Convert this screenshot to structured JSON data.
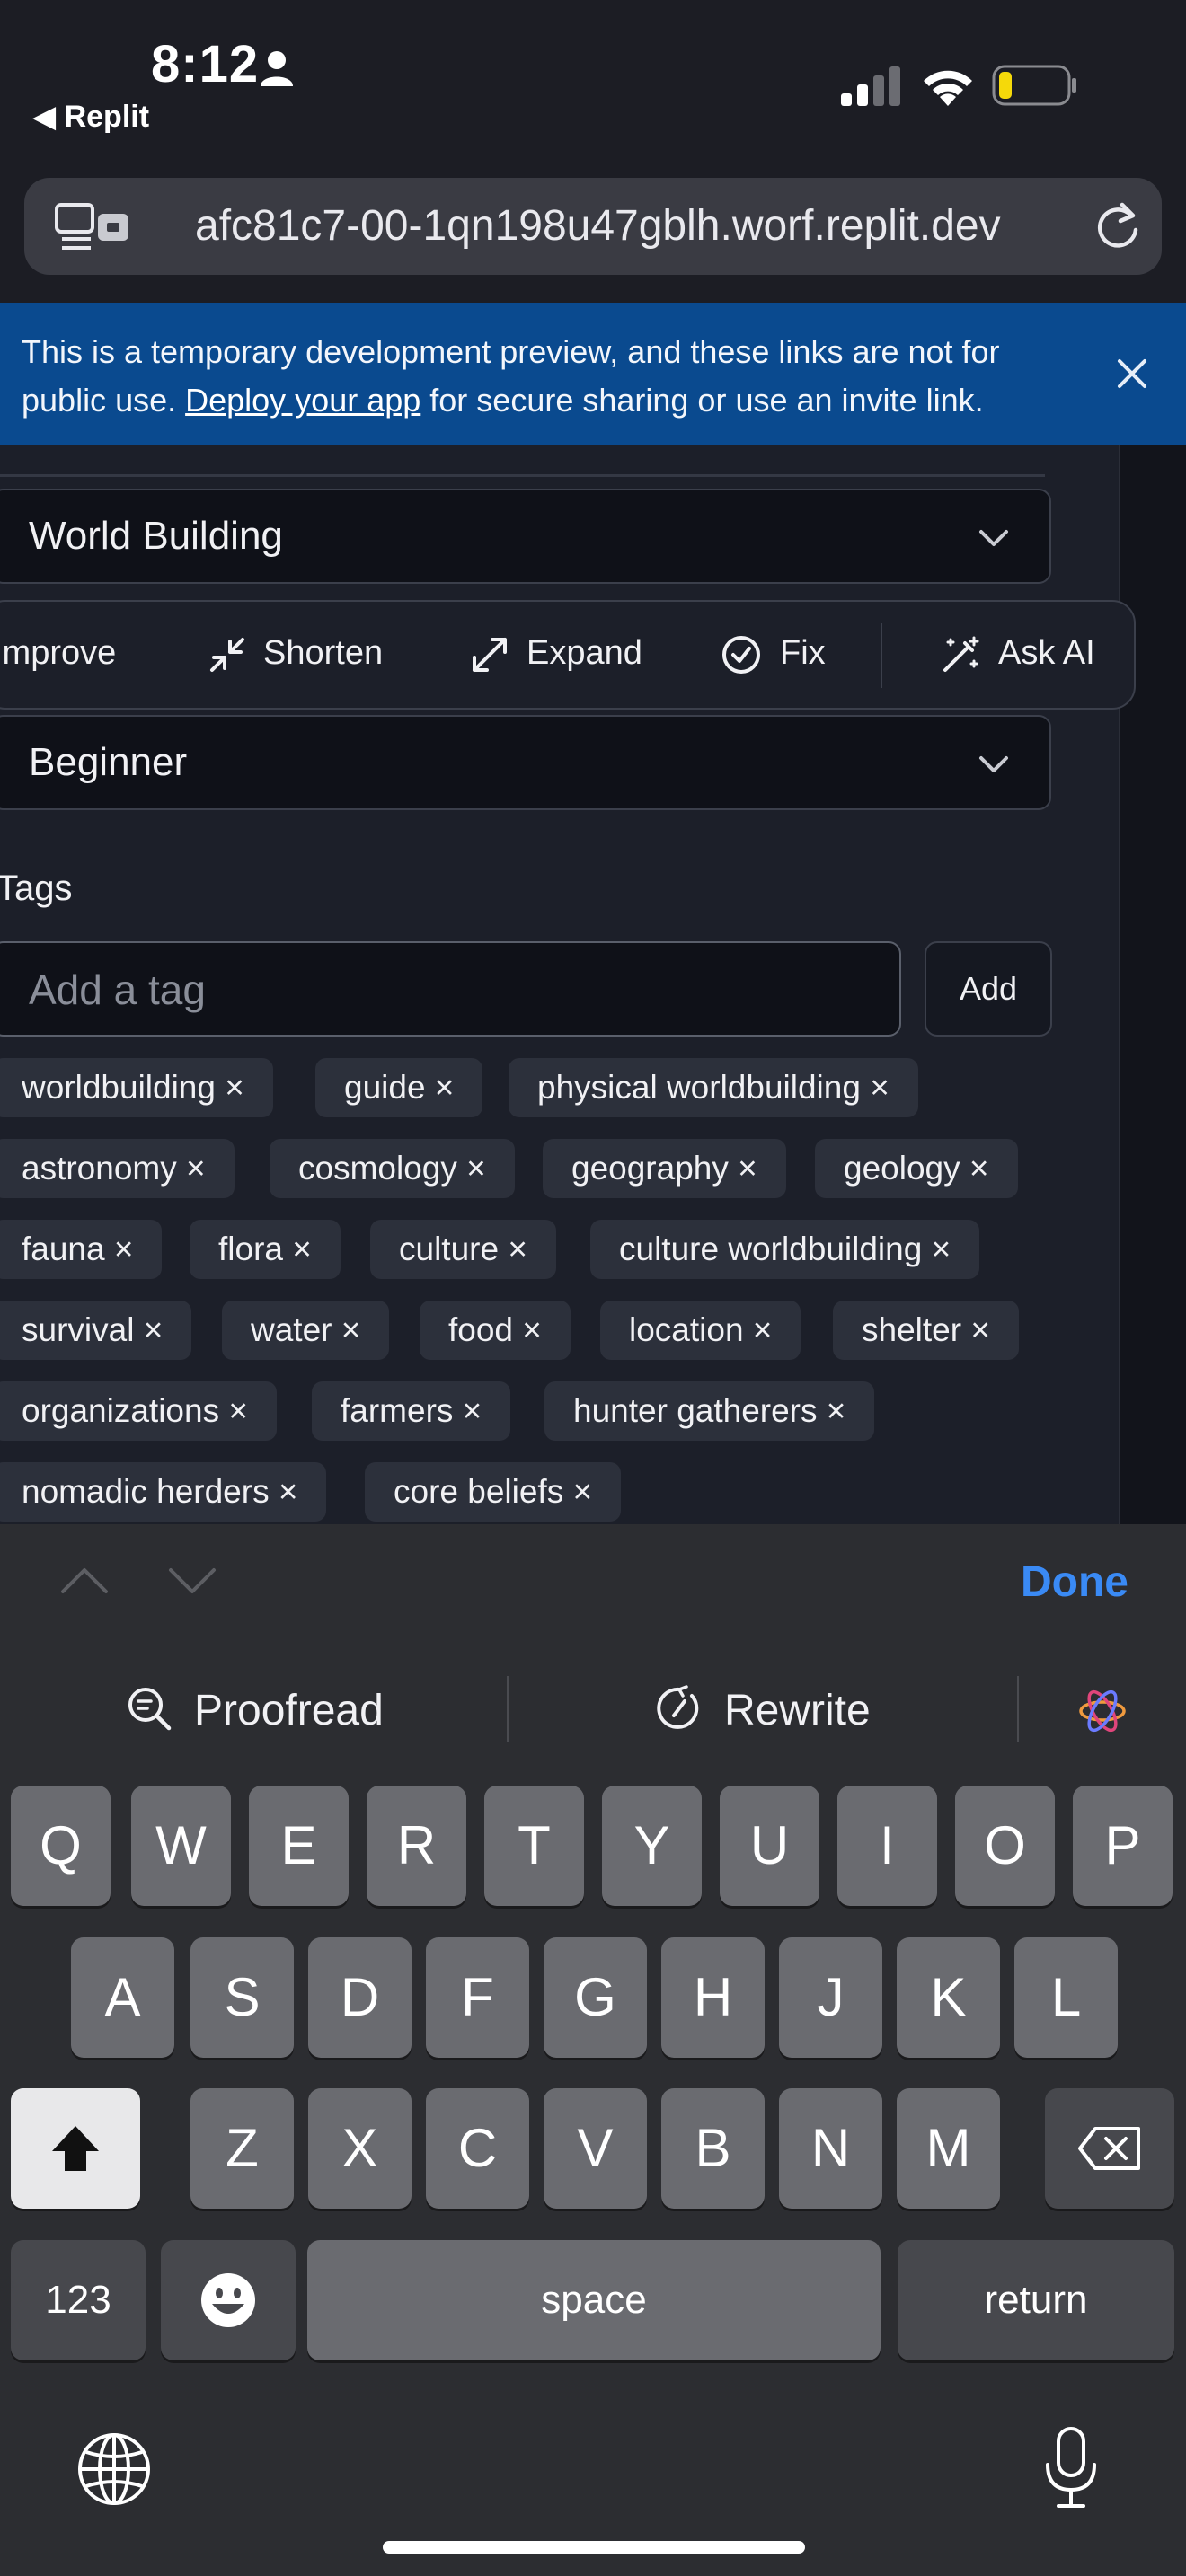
{
  "status_bar": {
    "time": "8:12",
    "back_app": "◀ Replit"
  },
  "browser": {
    "url": "afc81c7-00-1qn198u47gblh.worf.replit.dev"
  },
  "banner": {
    "text_before": "This is a temporary development preview, and these links are not for public use. ",
    "link": "Deploy your app",
    "text_after": " for secure sharing or use an invite link."
  },
  "form": {
    "category_value": "World Building",
    "difficulty_value": "Beginner",
    "tags_label": "Tags",
    "tag_input_placeholder": "Add a tag",
    "add_button": "Add"
  },
  "ai_toolbar": {
    "improve": "Improve",
    "shorten": "Shorten",
    "expand": "Expand",
    "fix": "Fix",
    "ask_ai": "Ask AI"
  },
  "tags": [
    "worldbuilding ×",
    "guide ×",
    "physical worldbuilding ×",
    "astronomy ×",
    "cosmology ×",
    "geography ×",
    "geology ×",
    "fauna ×",
    "flora ×",
    "culture ×",
    "culture worldbuilding ×",
    "survival ×",
    "water ×",
    "food ×",
    "location ×",
    "shelter ×",
    "organizations ×",
    "farmers ×",
    "hunter gatherers ×",
    "nomadic herders ×",
    "core beliefs ×"
  ],
  "keyboard": {
    "done": "Done",
    "proofread": "Proofread",
    "rewrite": "Rewrite",
    "row1": [
      "Q",
      "W",
      "E",
      "R",
      "T",
      "Y",
      "U",
      "I",
      "O",
      "P"
    ],
    "row2": [
      "A",
      "S",
      "D",
      "F",
      "G",
      "H",
      "J",
      "K",
      "L"
    ],
    "row3": [
      "Z",
      "X",
      "C",
      "V",
      "B",
      "N",
      "M"
    ],
    "numbers_key": "123",
    "space_key": "space",
    "return_key": "return"
  }
}
